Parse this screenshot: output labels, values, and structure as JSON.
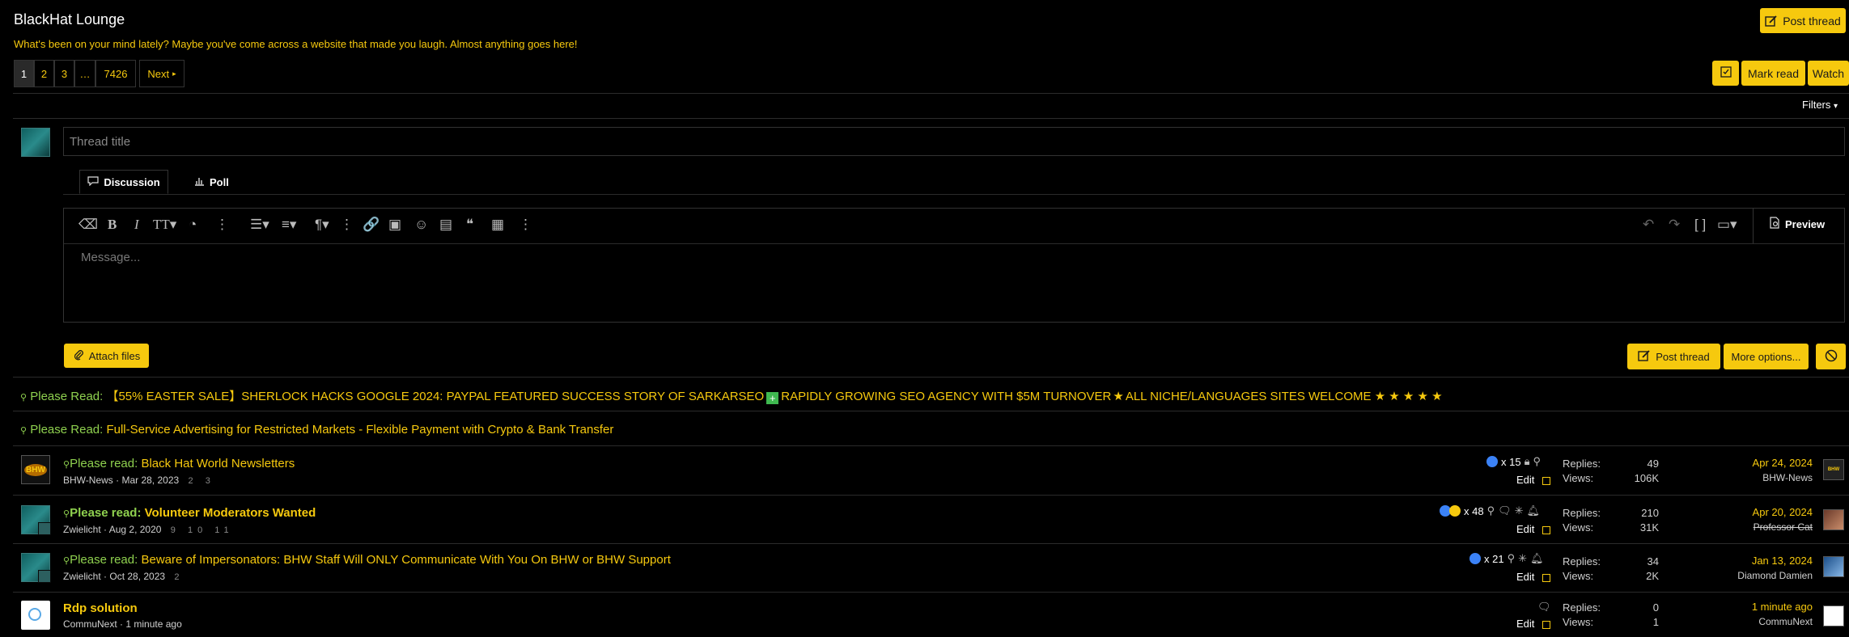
{
  "forum": {
    "title": "BlackHat Lounge",
    "description": "What's been on your mind lately? Maybe you've come across a website that made you laugh. Almost anything goes here!",
    "post_thread_label": "Post thread"
  },
  "pagination": {
    "pages": [
      "1",
      "2",
      "3",
      "…",
      "7426"
    ],
    "next_label": "Next",
    "current": "1"
  },
  "actions": {
    "mark_read": "Mark read",
    "watch": "Watch",
    "filters": "Filters"
  },
  "composer": {
    "title_placeholder": "Thread title",
    "tabs": [
      "Discussion",
      "Poll"
    ],
    "message_placeholder": "Message...",
    "preview_label": "Preview",
    "attach_label": "Attach files",
    "post_label": "Post thread",
    "more_options_label": "More options..."
  },
  "sticky_notices": [
    {
      "prefix": "Please Read:",
      "text": "【55% EASTER SALE】SHERLOCK HACKS GOOGLE 2024: PAYPAL FEATURED SUCCESS STORY OF SARKARSEO",
      "text2": "RAPIDLY GROWING SEO AGENCY WITH $5M TURNOVER",
      "text3": "ALL NICHE/LANGUAGES SITES WELCOME"
    },
    {
      "prefix": "Please Read:",
      "text": "Full-Service Advertising for Restricted Markets - Flexible Payment with Crypto & Bank Transfer"
    }
  ],
  "threads": [
    {
      "prefix": "Please read:",
      "title": "Black Hat World Newsletters",
      "bold": false,
      "author": "BHW-News",
      "date": "Mar 28, 2023",
      "pages": "2 3",
      "reactions": "x 15",
      "edit": "Edit",
      "replies_label": "Replies:",
      "replies": "49",
      "views_label": "Views:",
      "views": "106K",
      "last_date": "Apr 24, 2024",
      "last_user": "BHW-News",
      "last_user_strike": false
    },
    {
      "prefix": "Please read:",
      "title": "Volunteer Moderators Wanted",
      "bold": true,
      "author": "Zwielicht",
      "date": "Aug 2, 2020",
      "pages": "9 10 11",
      "reactions": "x 48",
      "edit": "Edit",
      "replies_label": "Replies:",
      "replies": "210",
      "views_label": "Views:",
      "views": "31K",
      "last_date": "Apr 20, 2024",
      "last_user": "Professor Cat",
      "last_user_strike": true
    },
    {
      "prefix": "Please read:",
      "title": "Beware of Impersonators: BHW Staff Will ONLY Communicate With You On BHW or BHW Support",
      "bold": false,
      "author": "Zwielicht",
      "date": "Oct 28, 2023",
      "pages": "2",
      "reactions": "x 21",
      "edit": "Edit",
      "replies_label": "Replies:",
      "replies": "34",
      "views_label": "Views:",
      "views": "2K",
      "last_date": "Jan 13, 2024",
      "last_user": "Diamond Damien",
      "last_user_strike": false
    },
    {
      "prefix": "",
      "title": "Rdp solution",
      "bold": true,
      "author": "CommuNext",
      "date": "1 minute ago",
      "pages": "",
      "reactions": "",
      "edit": "Edit",
      "replies_label": "Replies:",
      "replies": "0",
      "views_label": "Views:",
      "views": "1",
      "last_date": "1 minute ago",
      "last_user": "CommuNext",
      "last_user_strike": false
    }
  ],
  "avatars": {
    "bhw_logo_text": "BHW"
  },
  "colors": {
    "accent": "#f6c90e",
    "background": "#000000",
    "prefix_green": "#8fd14f"
  }
}
